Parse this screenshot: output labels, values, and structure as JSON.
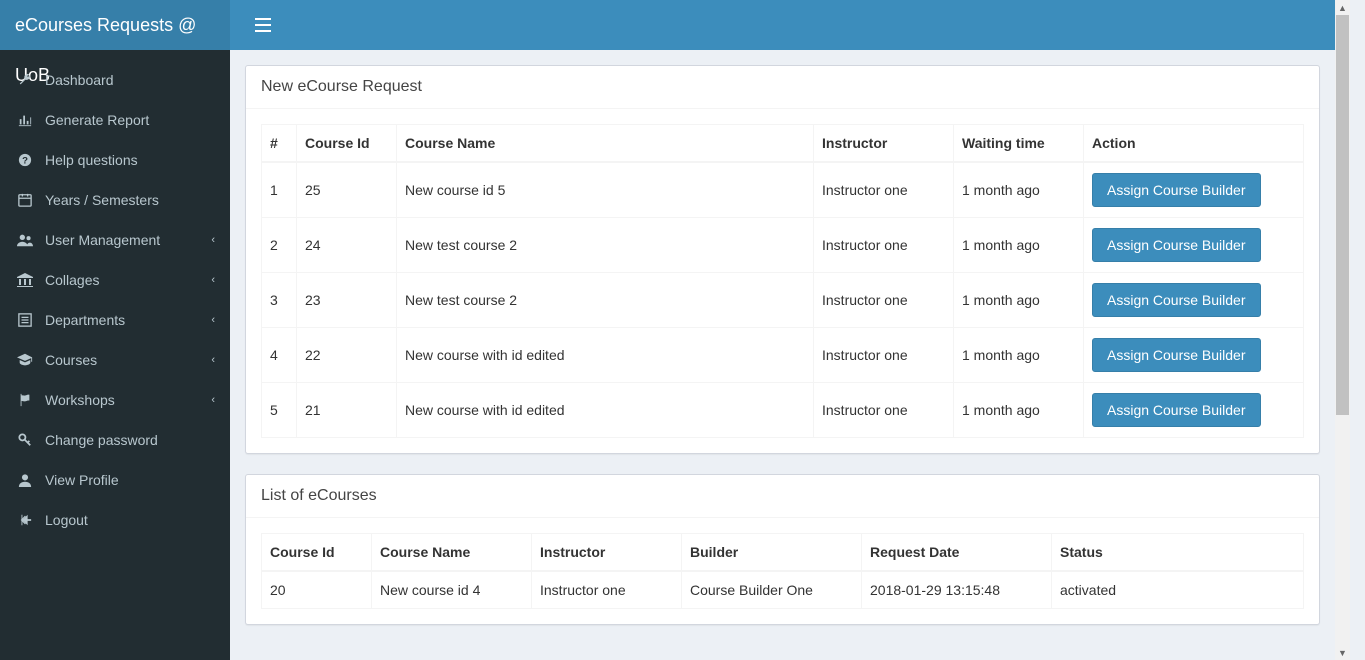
{
  "brand": "eCourses Requests @ UoB",
  "sidebar": {
    "items": [
      {
        "label": "Dashboard",
        "icon": "wrench",
        "expandable": false
      },
      {
        "label": "Generate Report",
        "icon": "bar-chart",
        "expandable": false
      },
      {
        "label": "Help questions",
        "icon": "question",
        "expandable": false
      },
      {
        "label": "Years / Semesters",
        "icon": "calendar",
        "expandable": false
      },
      {
        "label": "User Management",
        "icon": "users",
        "expandable": true
      },
      {
        "label": "Collages",
        "icon": "institution",
        "expandable": true
      },
      {
        "label": "Departments",
        "icon": "list",
        "expandable": true
      },
      {
        "label": "Courses",
        "icon": "graduation",
        "expandable": true
      },
      {
        "label": "Workshops",
        "icon": "flag",
        "expandable": true
      },
      {
        "label": "Change password",
        "icon": "key",
        "expandable": false
      },
      {
        "label": "View Profile",
        "icon": "user",
        "expandable": false
      },
      {
        "label": "Logout",
        "icon": "arrow-left",
        "expandable": false
      }
    ]
  },
  "panels": {
    "requests": {
      "title": "New eCourse Request",
      "headers": [
        "#",
        "Course Id",
        "Course Name",
        "Instructor",
        "Waiting time",
        "Action"
      ],
      "action_label": "Assign Course Builder",
      "rows": [
        {
          "n": "1",
          "id": "25",
          "name": "New course id 5",
          "instructor": "Instructor one",
          "waiting": "1 month ago"
        },
        {
          "n": "2",
          "id": "24",
          "name": "New test course 2",
          "instructor": "Instructor one",
          "waiting": "1 month ago"
        },
        {
          "n": "3",
          "id": "23",
          "name": "New test course 2",
          "instructor": "Instructor one",
          "waiting": "1 month ago"
        },
        {
          "n": "4",
          "id": "22",
          "name": "New course with id edited",
          "instructor": "Instructor one",
          "waiting": "1 month ago"
        },
        {
          "n": "5",
          "id": "21",
          "name": "New course with id edited",
          "instructor": "Instructor one",
          "waiting": "1 month ago"
        }
      ]
    },
    "list": {
      "title": "List of eCourses",
      "headers": [
        "Course Id",
        "Course Name",
        "Instructor",
        "Builder",
        "Request Date",
        "Status"
      ],
      "rows": [
        {
          "id": "20",
          "name": "New course id 4",
          "instructor": "Instructor one",
          "builder": "Course Builder One",
          "date": "2018-01-29 13:15:48",
          "status": "activated"
        }
      ]
    }
  }
}
